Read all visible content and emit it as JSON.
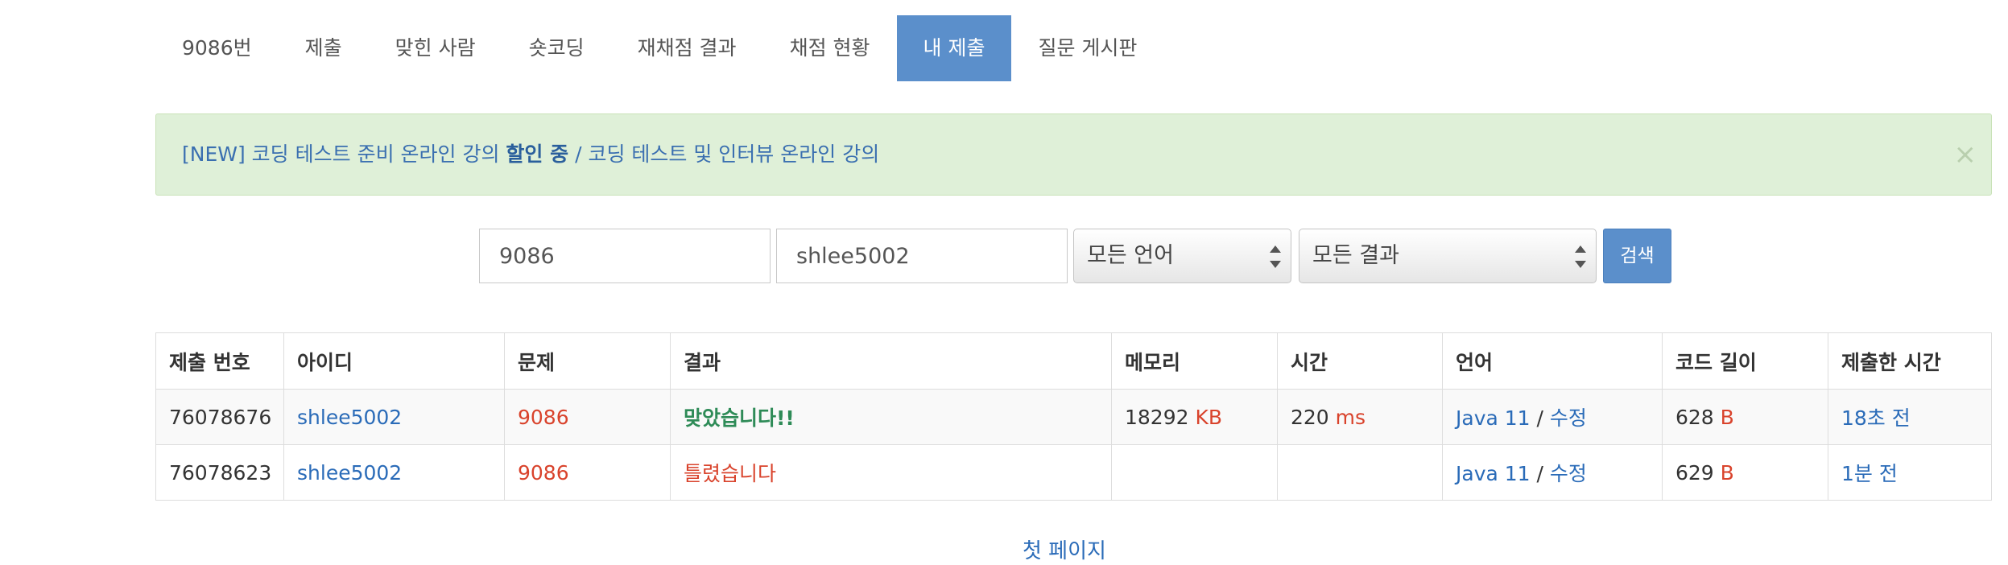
{
  "nav": {
    "items": [
      {
        "label": "9086번",
        "active": false
      },
      {
        "label": "제출",
        "active": false
      },
      {
        "label": "맞힌 사람",
        "active": false
      },
      {
        "label": "숏코딩",
        "active": false
      },
      {
        "label": "재채점 결과",
        "active": false
      },
      {
        "label": "채점 현황",
        "active": false
      },
      {
        "label": "내 제출",
        "active": true
      },
      {
        "label": "질문 게시판",
        "active": false
      }
    ]
  },
  "alert": {
    "link1_prefix": "[NEW] 코딩 테스트 준비 온라인 강의 ",
    "link1_bold": "할인 중",
    "separator": " / ",
    "link2": "코딩 테스트 및 인터뷰 온라인 강의",
    "close": "×"
  },
  "search": {
    "problem_value": "9086",
    "user_value": "shlee5002",
    "language_selected": "모든 언어",
    "result_selected": "모든 결과",
    "button": "검색"
  },
  "table": {
    "headers": [
      "제출 번호",
      "아이디",
      "문제",
      "결과",
      "메모리",
      "시간",
      "언어",
      "코드 길이",
      "제출한 시간"
    ],
    "rows": [
      {
        "id": "76078676",
        "user": "shlee5002",
        "problem": "9086",
        "result": "맞았습니다!!",
        "result_type": "ok",
        "memory": "18292",
        "memory_unit": "KB",
        "time": "220",
        "time_unit": "ms",
        "language": "Java 11",
        "edit": "수정",
        "code_length": "628",
        "code_unit": "B",
        "submitted": "18초 전"
      },
      {
        "id": "76078623",
        "user": "shlee5002",
        "problem": "9086",
        "result": "틀렸습니다",
        "result_type": "wrong",
        "memory": "",
        "memory_unit": "",
        "time": "",
        "time_unit": "",
        "language": "Java 11",
        "edit": "수정",
        "code_length": "629",
        "code_unit": "B",
        "submitted": "1분 전"
      }
    ]
  },
  "pager": {
    "first_page": "첫 페이지"
  },
  "colors": {
    "accent": "#5b8fcb",
    "link": "#2a6bb8",
    "error": "#d9432c",
    "success": "#2e8b57",
    "alert_bg": "#dff0d8"
  }
}
